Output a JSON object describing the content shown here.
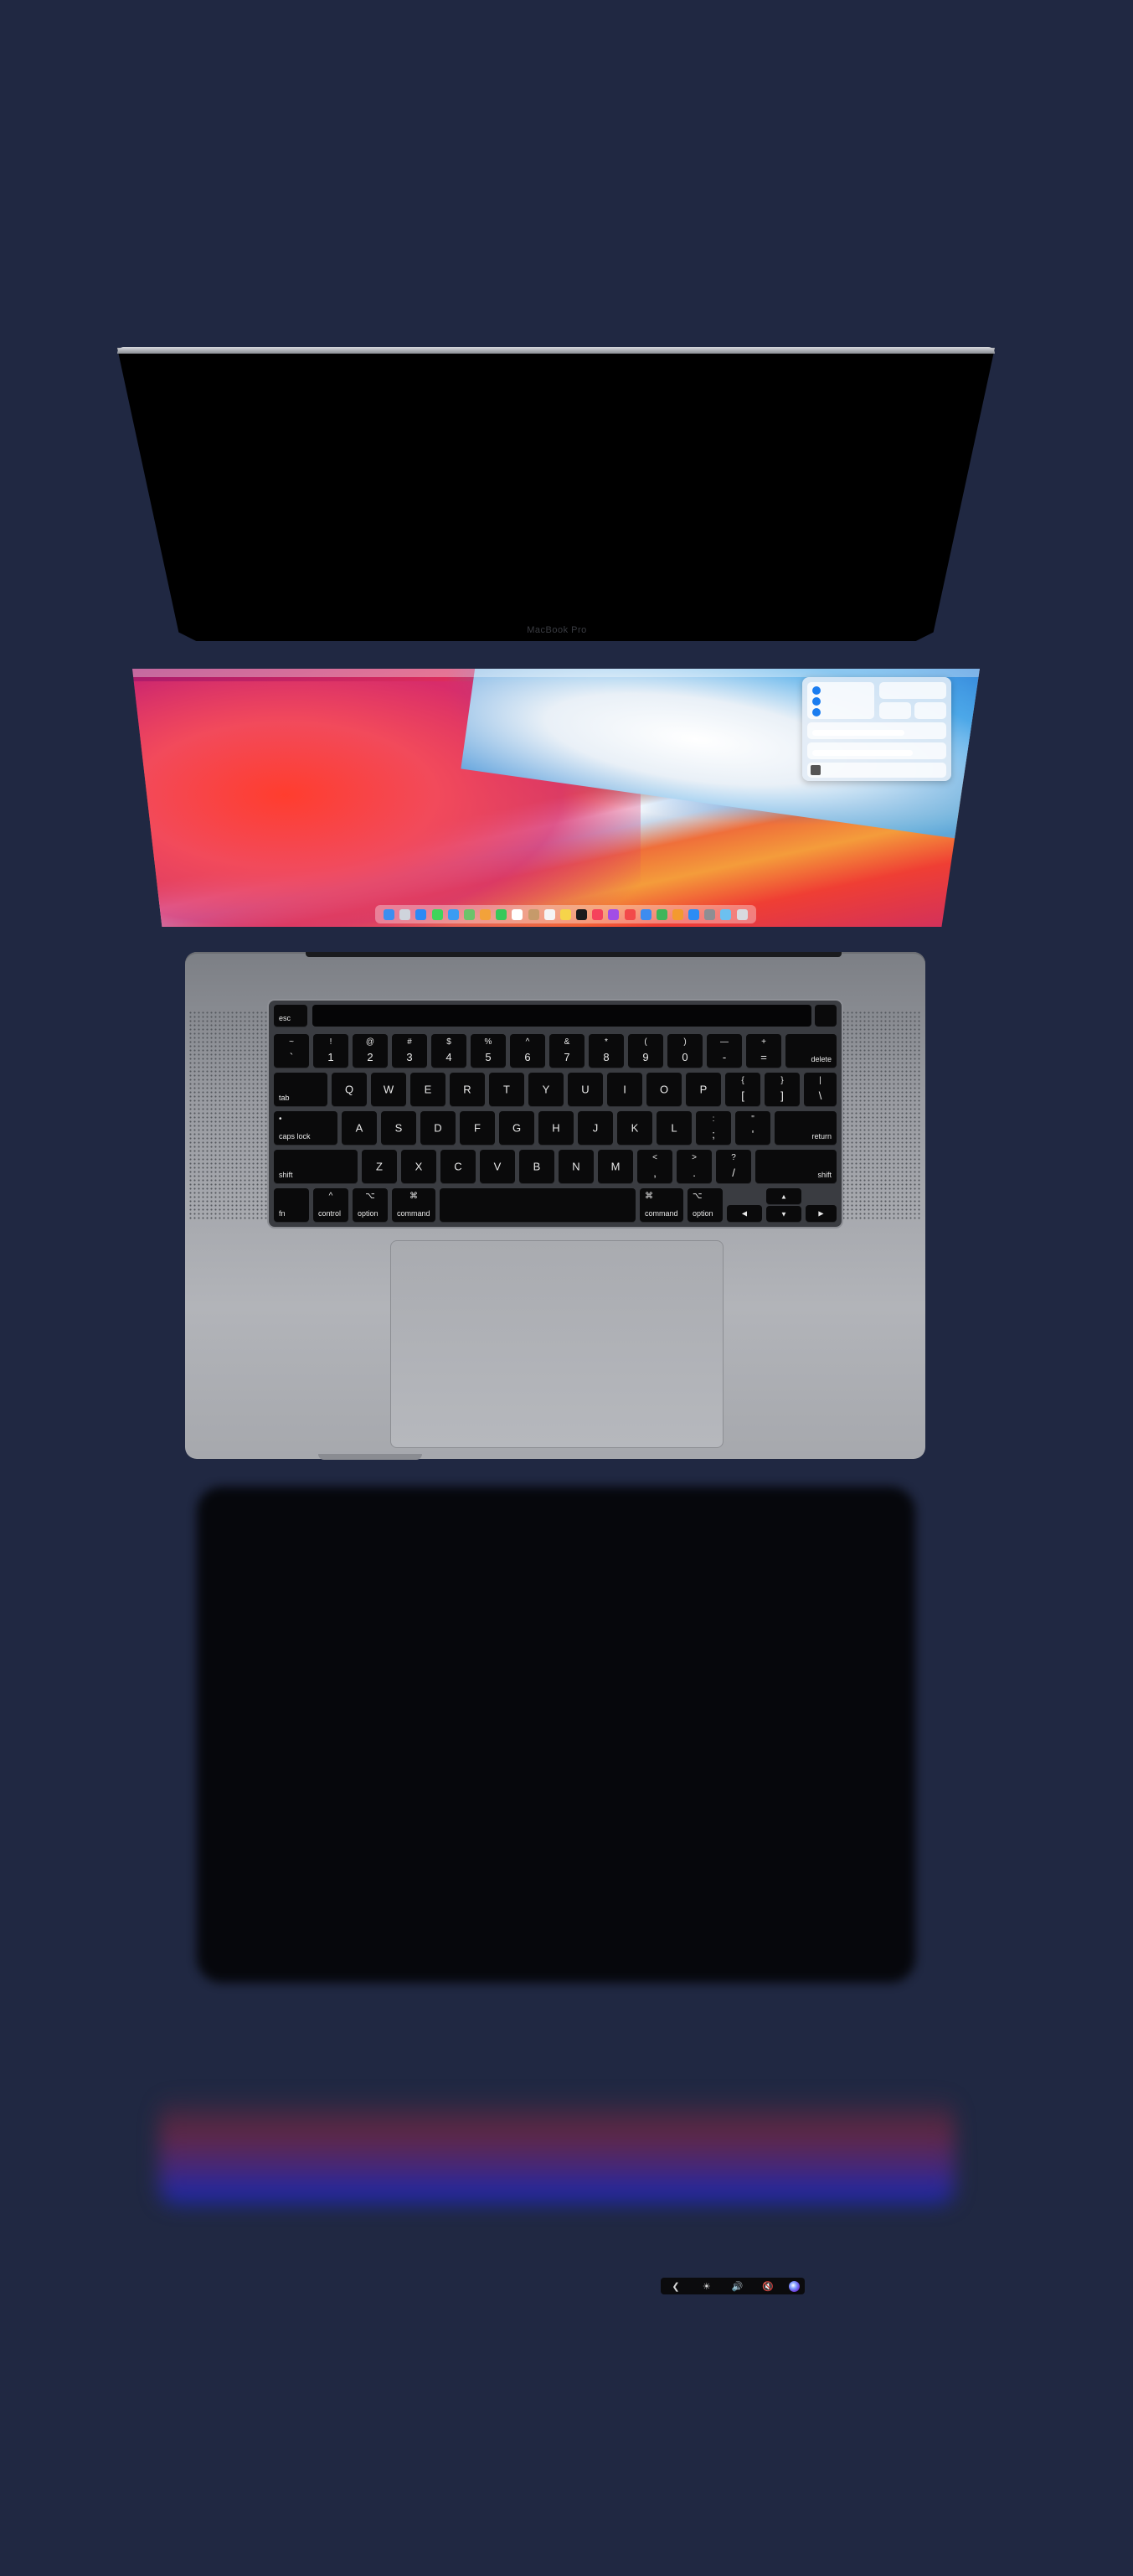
{
  "lid": {
    "brand": "MacBook Pro"
  },
  "colors": {
    "background": "#202842",
    "accent": "#1a7cf0"
  },
  "dock": {
    "icons": [
      {
        "name": "finder-icon",
        "color": "#3a8ef0"
      },
      {
        "name": "launchpad-icon",
        "color": "#cfd4dc"
      },
      {
        "name": "safari-icon",
        "color": "#2d89f5"
      },
      {
        "name": "messages-icon",
        "color": "#3fd45a"
      },
      {
        "name": "mail-icon",
        "color": "#3a9cf2"
      },
      {
        "name": "maps-icon",
        "color": "#6cc36b"
      },
      {
        "name": "photos-icon",
        "color": "#f2a23a"
      },
      {
        "name": "facetime-icon",
        "color": "#36c95a"
      },
      {
        "name": "calendar-icon",
        "color": "#ffffff"
      },
      {
        "name": "contacts-icon",
        "color": "#c69a6a"
      },
      {
        "name": "reminders-icon",
        "color": "#f5f5f5"
      },
      {
        "name": "notes-icon",
        "color": "#f6d44a"
      },
      {
        "name": "tv-icon",
        "color": "#1b1b1d"
      },
      {
        "name": "music-icon",
        "color": "#f5425c"
      },
      {
        "name": "podcasts-icon",
        "color": "#a24de6"
      },
      {
        "name": "news-icon",
        "color": "#f24a4a"
      },
      {
        "name": "keynote-icon",
        "color": "#3d8cf0"
      },
      {
        "name": "numbers-icon",
        "color": "#3fb55a"
      },
      {
        "name": "pages-icon",
        "color": "#f39a30"
      },
      {
        "name": "app-store-icon",
        "color": "#2c8cf4"
      },
      {
        "name": "system-preferences-icon",
        "color": "#8e8e93"
      },
      {
        "name": "folder-icon",
        "color": "#6cc0f0"
      },
      {
        "name": "trash-icon",
        "color": "#d8dadf"
      }
    ]
  },
  "keyboard": {
    "row0": {
      "esc": "esc"
    },
    "row1": [
      {
        "top": "~",
        "bot": "`"
      },
      {
        "top": "!",
        "bot": "1"
      },
      {
        "top": "@",
        "bot": "2"
      },
      {
        "top": "#",
        "bot": "3"
      },
      {
        "top": "$",
        "bot": "4"
      },
      {
        "top": "%",
        "bot": "5"
      },
      {
        "top": "^",
        "bot": "6"
      },
      {
        "top": "&",
        "bot": "7"
      },
      {
        "top": "*",
        "bot": "8"
      },
      {
        "top": "(",
        "bot": "9"
      },
      {
        "top": ")",
        "bot": "0"
      },
      {
        "top": "—",
        "bot": "-"
      },
      {
        "top": "+",
        "bot": "="
      }
    ],
    "delete": "delete",
    "tab": "tab",
    "row2": [
      "Q",
      "W",
      "E",
      "R",
      "T",
      "Y",
      "U",
      "I",
      "O",
      "P"
    ],
    "row2_punct": [
      {
        "top": "{",
        "bot": "["
      },
      {
        "top": "}",
        "bot": "]"
      },
      {
        "top": "|",
        "bot": "\\"
      }
    ],
    "caps_lock": "caps lock",
    "row3": [
      "A",
      "S",
      "D",
      "F",
      "G",
      "H",
      "J",
      "K",
      "L"
    ],
    "row3_punct": [
      {
        "top": ":",
        "bot": ";"
      },
      {
        "top": "\"",
        "bot": "'"
      }
    ],
    "return": "return",
    "shift_left": "shift",
    "row4": [
      "Z",
      "X",
      "C",
      "V",
      "B",
      "N",
      "M"
    ],
    "row4_punct": [
      {
        "top": "<",
        "bot": ","
      },
      {
        "top": ">",
        "bot": "."
      },
      {
        "top": "?",
        "bot": "/"
      }
    ],
    "shift_right": "shift",
    "fn": "fn",
    "control": {
      "sym": "^",
      "label": "control"
    },
    "option_left": {
      "sym": "⌥",
      "label": "option"
    },
    "command_left": {
      "sym": "⌘",
      "label": "command"
    },
    "command_right": {
      "sym": "⌘",
      "label": "command"
    },
    "option_right": {
      "sym": "⌥",
      "label": "option"
    },
    "arrows": {
      "left": "◀",
      "up": "▲",
      "down": "▼",
      "right": "▶"
    }
  },
  "touchbar": {
    "items": [
      {
        "name": "collapse-icon",
        "glyph": "❮"
      },
      {
        "name": "brightness-icon",
        "glyph": "☀"
      },
      {
        "name": "volume-icon",
        "glyph": "🔊"
      },
      {
        "name": "mute-icon",
        "glyph": "🔇"
      }
    ]
  }
}
